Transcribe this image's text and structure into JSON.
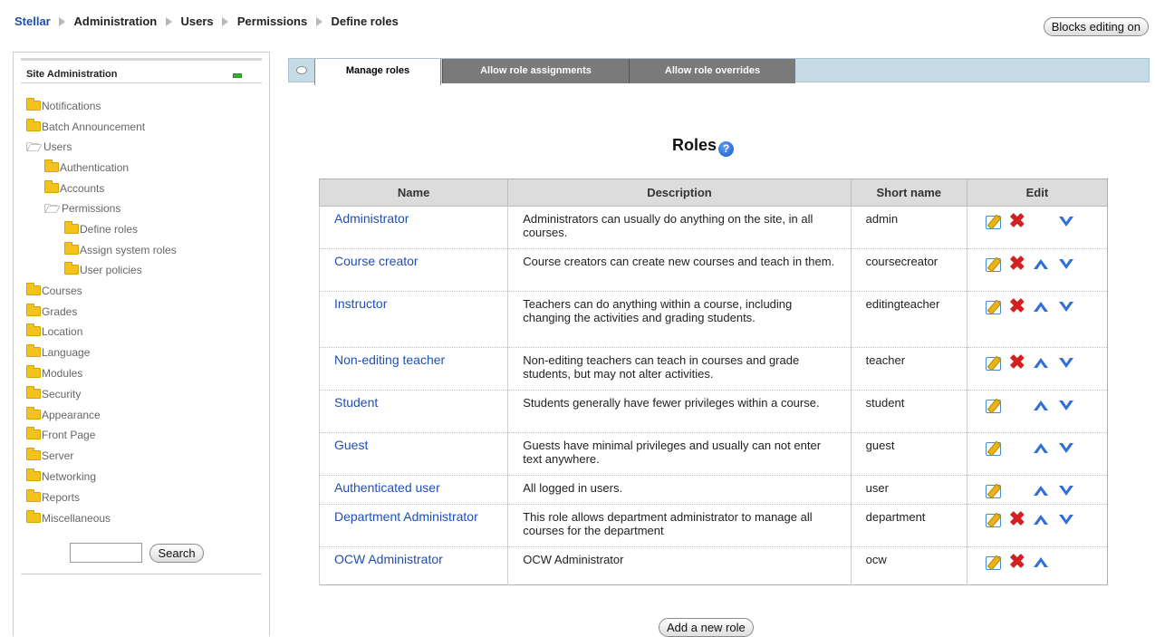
{
  "breadcrumb": {
    "home": "Stellar",
    "items": [
      "Administration",
      "Users",
      "Permissions",
      "Define roles"
    ]
  },
  "header": {
    "blocks_editing_label": "Blocks editing on"
  },
  "sidebar": {
    "title": "Site Administration",
    "items": [
      {
        "label": "Notifications",
        "icon": "folder-icon"
      },
      {
        "label": "Batch Announcement",
        "icon": "folder-icon"
      },
      {
        "label": "Users",
        "icon": "open-folder-icon"
      },
      {
        "label": "Authentication",
        "icon": "folder-icon"
      },
      {
        "label": "Accounts",
        "icon": "folder-icon"
      },
      {
        "label": "Permissions",
        "icon": "open-folder-icon"
      },
      {
        "label": "Define roles",
        "icon": "folder-icon"
      },
      {
        "label": "Assign system roles",
        "icon": "folder-icon"
      },
      {
        "label": "User policies",
        "icon": "folder-icon"
      },
      {
        "label": "Courses",
        "icon": "folder-icon"
      },
      {
        "label": "Grades",
        "icon": "folder-icon"
      },
      {
        "label": "Location",
        "icon": "folder-icon"
      },
      {
        "label": "Language",
        "icon": "folder-icon"
      },
      {
        "label": "Modules",
        "icon": "folder-icon"
      },
      {
        "label": "Security",
        "icon": "folder-icon"
      },
      {
        "label": "Appearance",
        "icon": "folder-icon"
      },
      {
        "label": "Front Page",
        "icon": "folder-icon"
      },
      {
        "label": "Server",
        "icon": "folder-icon"
      },
      {
        "label": "Networking",
        "icon": "folder-icon"
      },
      {
        "label": "Reports",
        "icon": "folder-icon"
      },
      {
        "label": "Miscellaneous",
        "icon": "folder-icon"
      }
    ],
    "search": {
      "value": "",
      "button_label": "Search"
    }
  },
  "tabs": [
    {
      "label": "Manage roles",
      "active": true
    },
    {
      "label": "Allow role assignments",
      "active": false
    },
    {
      "label": "Allow role overrides",
      "active": false
    }
  ],
  "main": {
    "heading": "Roles",
    "help_icon": "?",
    "columns": [
      "Name",
      "Description",
      "Short name",
      "Edit"
    ],
    "roles": [
      {
        "name": "Administrator",
        "description": "Administrators can usually do anything on the site, in all courses.",
        "short": "admin"
      },
      {
        "name": "Course creator",
        "description": "Course creators can create new courses and teach in them.",
        "short": "coursecreator"
      },
      {
        "name": "Instructor",
        "description": "Teachers can do anything within a course, including changing the activities and grading students.",
        "short": "editingteacher"
      },
      {
        "name": "Non-editing teacher",
        "description": "Non-editing teachers can teach in courses and grade students, but may not alter activities.",
        "short": "teacher"
      },
      {
        "name": "Student",
        "description": "Students generally have fewer privileges within a course.",
        "short": "student"
      },
      {
        "name": "Guest",
        "description": "Guests have minimal privileges and usually can not enter text anywhere.",
        "short": "guest"
      },
      {
        "name": "Authenticated user",
        "description": "All logged in users.",
        "short": "user"
      },
      {
        "name": "Department Administrator",
        "description": "This role allows department administrator to manage all courses for the department",
        "short": "department"
      },
      {
        "name": "OCW Administrator",
        "description": "OCW Administrator",
        "short": "ocw"
      }
    ],
    "add_role_label": "Add a new role"
  },
  "colors": {
    "link": "#1f4fb3",
    "tabbar": "#c6dbe6",
    "tab_inactive": "#7a7a7a",
    "delete": "#d42020",
    "arrow": "#2f6fd6"
  }
}
